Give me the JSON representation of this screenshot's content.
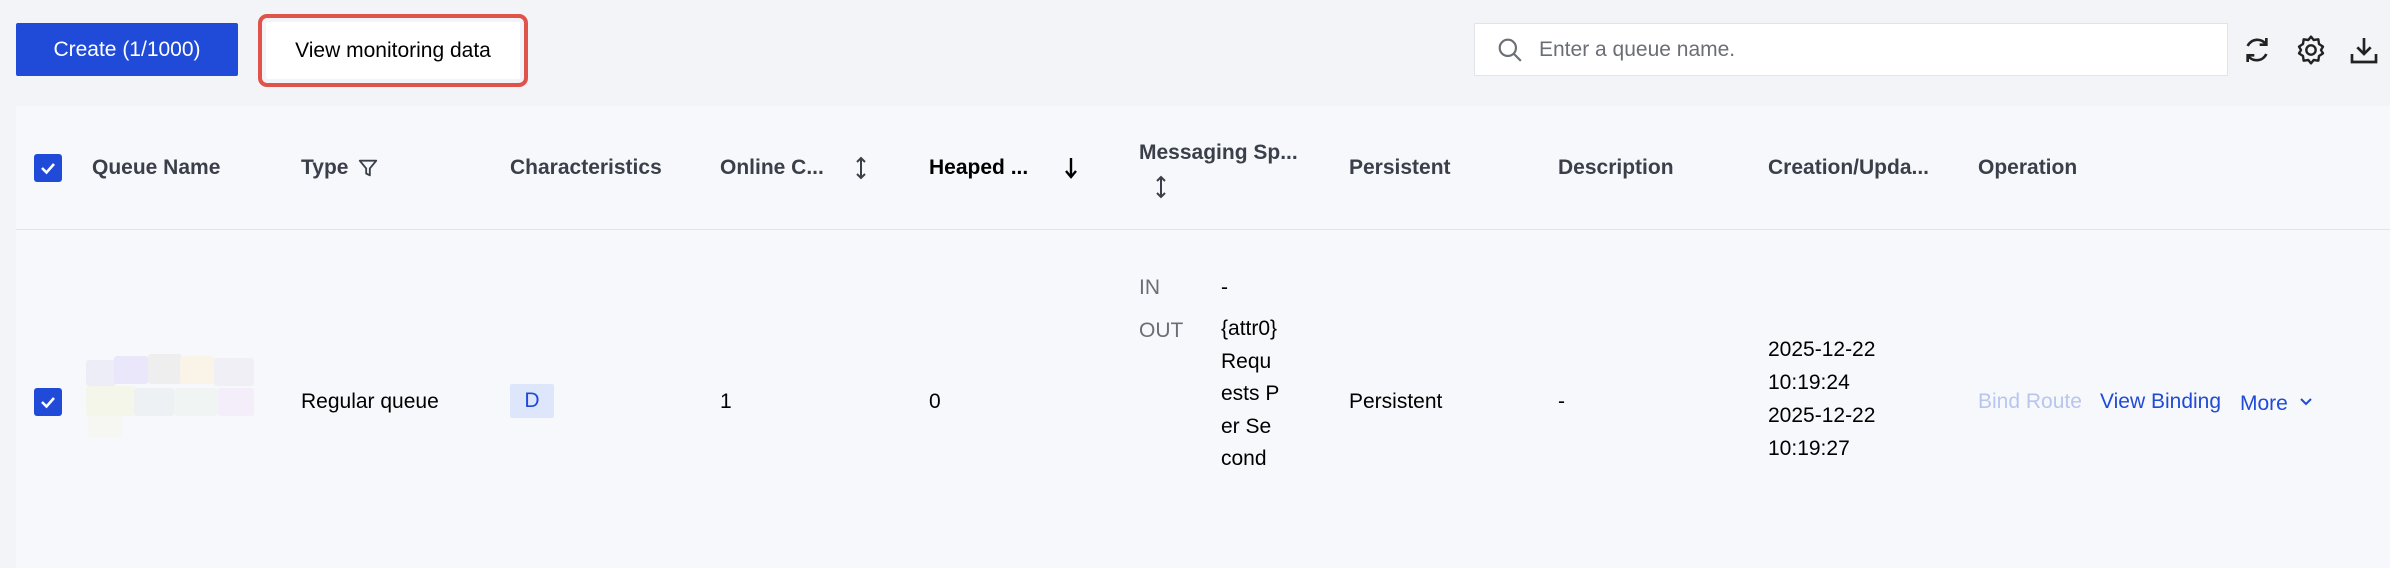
{
  "toolbar": {
    "create_label": "Create (1/1000)",
    "monitor_label": "View monitoring data",
    "search_placeholder": "Enter a queue name."
  },
  "table": {
    "columns": {
      "queue_name": "Queue Name",
      "type": "Type",
      "characteristics": "Characteristics",
      "online_consumers": "Online C...",
      "heaped": "Heaped ...",
      "messaging_speed": "Messaging Sp...",
      "persistent": "Persistent",
      "description": "Description",
      "creation_update": "Creation/Upda...",
      "operation": "Operation"
    },
    "rows": [
      {
        "type": "Regular queue",
        "characteristics_tag": "D",
        "online_consumers": "1",
        "heaped": "0",
        "speed_in_label": "IN",
        "speed_in_value": "-",
        "speed_out_label": "OUT",
        "speed_out_value": "{attr0}Requests Per Second",
        "persistent": "Persistent",
        "description": "-",
        "created": "2025-12-22 10:19:24",
        "updated": "2025-12-22 10:19:27",
        "op_bind_route": "Bind Route",
        "op_view_binding": "View Binding",
        "op_more": "More"
      }
    ]
  },
  "colors": {
    "primary": "#1f4bd8",
    "highlight_border": "#e0534a",
    "disabled_link": "#b8c6ef"
  },
  "icons": [
    "search-icon",
    "refresh-icon",
    "settings-icon",
    "download-icon",
    "filter-icon",
    "sort-icon",
    "sort-desc-icon",
    "chevron-down-icon",
    "check-icon"
  ]
}
